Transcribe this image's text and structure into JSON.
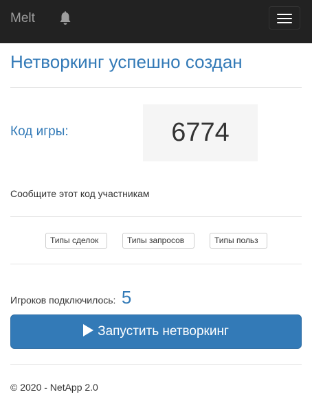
{
  "navbar": {
    "brand": "Melt",
    "bell_icon": "bell-icon",
    "menu_icon": "hamburger-menu-icon"
  },
  "main": {
    "title": "Нетворкинг успешно создан",
    "code_label": "Код игры:",
    "code_value": "6774",
    "hint": "Сообщите этот код участникам",
    "chips": [
      "Типы сделок",
      "Типы запросов",
      "Типы польз"
    ],
    "players_label": "Игроков подключилось:",
    "players_count": "5",
    "start_button": "Запустить нетворкинг",
    "start_icon": "play-icon"
  },
  "footer": {
    "text": "© 2020 - NetApp 2.0"
  },
  "colors": {
    "navbar_bg": "#222222",
    "accent": "#337ab7",
    "code_box_bg": "#f5f5f5"
  }
}
